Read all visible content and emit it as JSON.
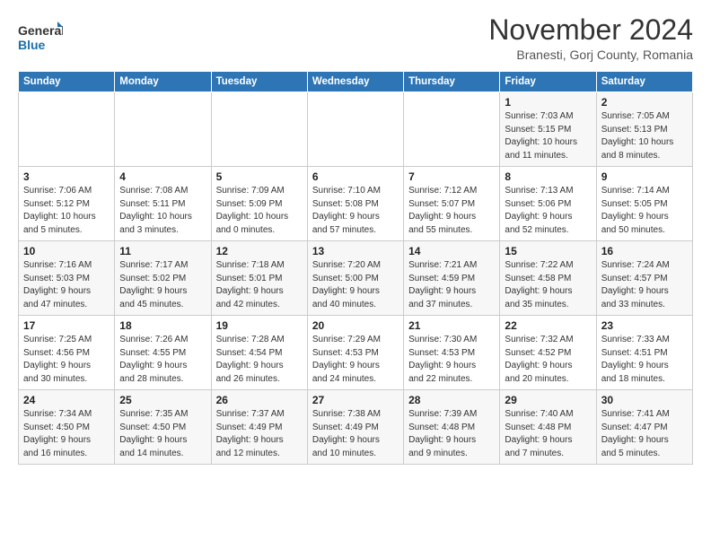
{
  "logo": {
    "general": "General",
    "blue": "Blue"
  },
  "title": "November 2024",
  "subtitle": "Branesti, Gorj County, Romania",
  "weekdays": [
    "Sunday",
    "Monday",
    "Tuesday",
    "Wednesday",
    "Thursday",
    "Friday",
    "Saturday"
  ],
  "weeks": [
    [
      {
        "day": "",
        "info": ""
      },
      {
        "day": "",
        "info": ""
      },
      {
        "day": "",
        "info": ""
      },
      {
        "day": "",
        "info": ""
      },
      {
        "day": "",
        "info": ""
      },
      {
        "day": "1",
        "info": "Sunrise: 7:03 AM\nSunset: 5:15 PM\nDaylight: 10 hours\nand 11 minutes."
      },
      {
        "day": "2",
        "info": "Sunrise: 7:05 AM\nSunset: 5:13 PM\nDaylight: 10 hours\nand 8 minutes."
      }
    ],
    [
      {
        "day": "3",
        "info": "Sunrise: 7:06 AM\nSunset: 5:12 PM\nDaylight: 10 hours\nand 5 minutes."
      },
      {
        "day": "4",
        "info": "Sunrise: 7:08 AM\nSunset: 5:11 PM\nDaylight: 10 hours\nand 3 minutes."
      },
      {
        "day": "5",
        "info": "Sunrise: 7:09 AM\nSunset: 5:09 PM\nDaylight: 10 hours\nand 0 minutes."
      },
      {
        "day": "6",
        "info": "Sunrise: 7:10 AM\nSunset: 5:08 PM\nDaylight: 9 hours\nand 57 minutes."
      },
      {
        "day": "7",
        "info": "Sunrise: 7:12 AM\nSunset: 5:07 PM\nDaylight: 9 hours\nand 55 minutes."
      },
      {
        "day": "8",
        "info": "Sunrise: 7:13 AM\nSunset: 5:06 PM\nDaylight: 9 hours\nand 52 minutes."
      },
      {
        "day": "9",
        "info": "Sunrise: 7:14 AM\nSunset: 5:05 PM\nDaylight: 9 hours\nand 50 minutes."
      }
    ],
    [
      {
        "day": "10",
        "info": "Sunrise: 7:16 AM\nSunset: 5:03 PM\nDaylight: 9 hours\nand 47 minutes."
      },
      {
        "day": "11",
        "info": "Sunrise: 7:17 AM\nSunset: 5:02 PM\nDaylight: 9 hours\nand 45 minutes."
      },
      {
        "day": "12",
        "info": "Sunrise: 7:18 AM\nSunset: 5:01 PM\nDaylight: 9 hours\nand 42 minutes."
      },
      {
        "day": "13",
        "info": "Sunrise: 7:20 AM\nSunset: 5:00 PM\nDaylight: 9 hours\nand 40 minutes."
      },
      {
        "day": "14",
        "info": "Sunrise: 7:21 AM\nSunset: 4:59 PM\nDaylight: 9 hours\nand 37 minutes."
      },
      {
        "day": "15",
        "info": "Sunrise: 7:22 AM\nSunset: 4:58 PM\nDaylight: 9 hours\nand 35 minutes."
      },
      {
        "day": "16",
        "info": "Sunrise: 7:24 AM\nSunset: 4:57 PM\nDaylight: 9 hours\nand 33 minutes."
      }
    ],
    [
      {
        "day": "17",
        "info": "Sunrise: 7:25 AM\nSunset: 4:56 PM\nDaylight: 9 hours\nand 30 minutes."
      },
      {
        "day": "18",
        "info": "Sunrise: 7:26 AM\nSunset: 4:55 PM\nDaylight: 9 hours\nand 28 minutes."
      },
      {
        "day": "19",
        "info": "Sunrise: 7:28 AM\nSunset: 4:54 PM\nDaylight: 9 hours\nand 26 minutes."
      },
      {
        "day": "20",
        "info": "Sunrise: 7:29 AM\nSunset: 4:53 PM\nDaylight: 9 hours\nand 24 minutes."
      },
      {
        "day": "21",
        "info": "Sunrise: 7:30 AM\nSunset: 4:53 PM\nDaylight: 9 hours\nand 22 minutes."
      },
      {
        "day": "22",
        "info": "Sunrise: 7:32 AM\nSunset: 4:52 PM\nDaylight: 9 hours\nand 20 minutes."
      },
      {
        "day": "23",
        "info": "Sunrise: 7:33 AM\nSunset: 4:51 PM\nDaylight: 9 hours\nand 18 minutes."
      }
    ],
    [
      {
        "day": "24",
        "info": "Sunrise: 7:34 AM\nSunset: 4:50 PM\nDaylight: 9 hours\nand 16 minutes."
      },
      {
        "day": "25",
        "info": "Sunrise: 7:35 AM\nSunset: 4:50 PM\nDaylight: 9 hours\nand 14 minutes."
      },
      {
        "day": "26",
        "info": "Sunrise: 7:37 AM\nSunset: 4:49 PM\nDaylight: 9 hours\nand 12 minutes."
      },
      {
        "day": "27",
        "info": "Sunrise: 7:38 AM\nSunset: 4:49 PM\nDaylight: 9 hours\nand 10 minutes."
      },
      {
        "day": "28",
        "info": "Sunrise: 7:39 AM\nSunset: 4:48 PM\nDaylight: 9 hours\nand 9 minutes."
      },
      {
        "day": "29",
        "info": "Sunrise: 7:40 AM\nSunset: 4:48 PM\nDaylight: 9 hours\nand 7 minutes."
      },
      {
        "day": "30",
        "info": "Sunrise: 7:41 AM\nSunset: 4:47 PM\nDaylight: 9 hours\nand 5 minutes."
      }
    ]
  ]
}
